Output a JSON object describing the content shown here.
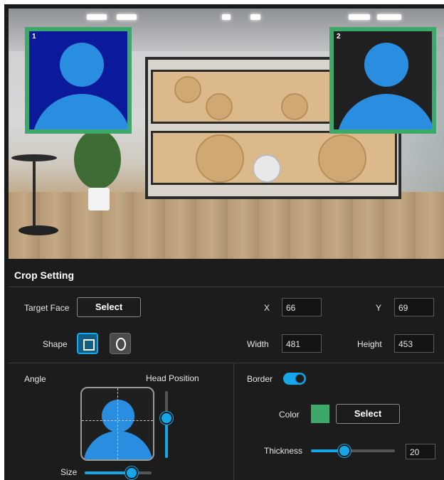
{
  "preview": {
    "faces": [
      {
        "number": "1",
        "background": "#0a1a9a"
      },
      {
        "number": "2",
        "background": "#202020"
      }
    ],
    "border_color": "#3ea86a"
  },
  "crop_setting": {
    "title": "Crop Setting",
    "target_face": {
      "label": "Target Face",
      "button": "Select"
    },
    "x": {
      "label": "X",
      "value": "66"
    },
    "y": {
      "label": "Y",
      "value": "69"
    },
    "shape": {
      "label": "Shape",
      "options": [
        "square",
        "circle"
      ],
      "selected": "square"
    },
    "width": {
      "label": "Width",
      "value": "481"
    },
    "height": {
      "label": "Height",
      "value": "453"
    }
  },
  "angle": {
    "label": "Angle",
    "head_position_label": "Head Position",
    "size_label": "Size",
    "size_level": 0.7,
    "head_position_level": 0.6
  },
  "border": {
    "label": "Border",
    "enabled": true,
    "color_label": "Color",
    "color": "#3ea86a",
    "color_button": "Select",
    "thickness_label": "Thickness",
    "thickness_value": "20",
    "thickness_level": 0.4
  },
  "accent": "#16a7e8"
}
